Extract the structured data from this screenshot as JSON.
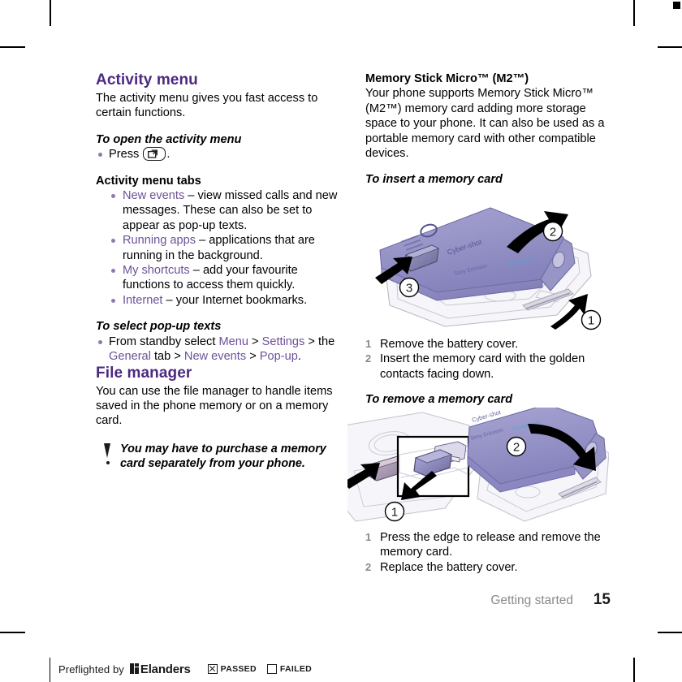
{
  "page": {
    "running_footer_label": "Getting started",
    "page_number": "15"
  },
  "left_column": {
    "activity_menu": {
      "title": "Activity menu",
      "intro": "The activity menu gives you fast access to certain functions.",
      "open_subhead": "To open the activity menu",
      "open_step_prefix": "Press",
      "open_step_suffix": ".",
      "key_icon": "activity-menu-key-icon",
      "tabs_head": "Activity menu tabs",
      "tabs": [
        {
          "link": "New events",
          "text": " – view missed calls and new messages. These can also be set to appear as pop-up texts."
        },
        {
          "link": "Running apps",
          "text": " – applications that are running in the background."
        },
        {
          "link": "My shortcuts",
          "text": " – add your favourite functions to access them quickly."
        },
        {
          "link": "Internet",
          "text": " – your Internet bookmarks."
        }
      ],
      "popup_subhead": "To select pop-up texts",
      "popup_step": {
        "t1": "From standby select ",
        "l1": "Menu",
        "t2": " > ",
        "l2": "Settings",
        "t3": " > the ",
        "l3": "General",
        "t4": " tab > ",
        "l4": "New events",
        "t5": " > ",
        "l5": "Pop-up",
        "t6": "."
      }
    },
    "file_manager": {
      "title": "File manager",
      "body": "You can use the file manager to handle items saved in the phone memory or on a memory card.",
      "note": "You may have to purchase a memory card separately from your phone."
    }
  },
  "right_column": {
    "memory_stick": {
      "head": "Memory Stick Micro™ (M2™)",
      "body": "Your phone supports Memory Stick Micro™ (M2™) memory card adding more storage space to your phone. It can also be used as a portable memory card with other compatible devices."
    },
    "insert": {
      "subhead": "To insert a memory card",
      "illustration": "phone-battery-cover-insert-card-illustration",
      "callouts": [
        "1",
        "2",
        "3"
      ],
      "steps": [
        {
          "num": "1",
          "text": "Remove the battery cover."
        },
        {
          "num": "2",
          "text": "Insert the memory card with the golden contacts facing down."
        }
      ]
    },
    "remove": {
      "subhead": "To remove a memory card",
      "illustration": "phone-remove-card-replace-cover-illustration",
      "callouts": [
        "1",
        "2"
      ],
      "steps": [
        {
          "num": "1",
          "text": "Press the edge to release and remove the memory card."
        },
        {
          "num": "2",
          "text": "Replace the battery cover."
        }
      ]
    }
  },
  "footer": {
    "preflighted_by": "Preflighted by",
    "company": "Elanders",
    "passed_label": "PASSED",
    "failed_label": "FAILED",
    "passed_checked": true,
    "failed_checked": false
  },
  "colors": {
    "heading_purple": "#4b2a80",
    "link_purple": "#6d5299",
    "bullet_purple": "#8d7bb0",
    "step_number_grey": "#8a8a8a",
    "illustration_cover": "#8e8bc4",
    "illustration_body": "#f2f1f6"
  }
}
